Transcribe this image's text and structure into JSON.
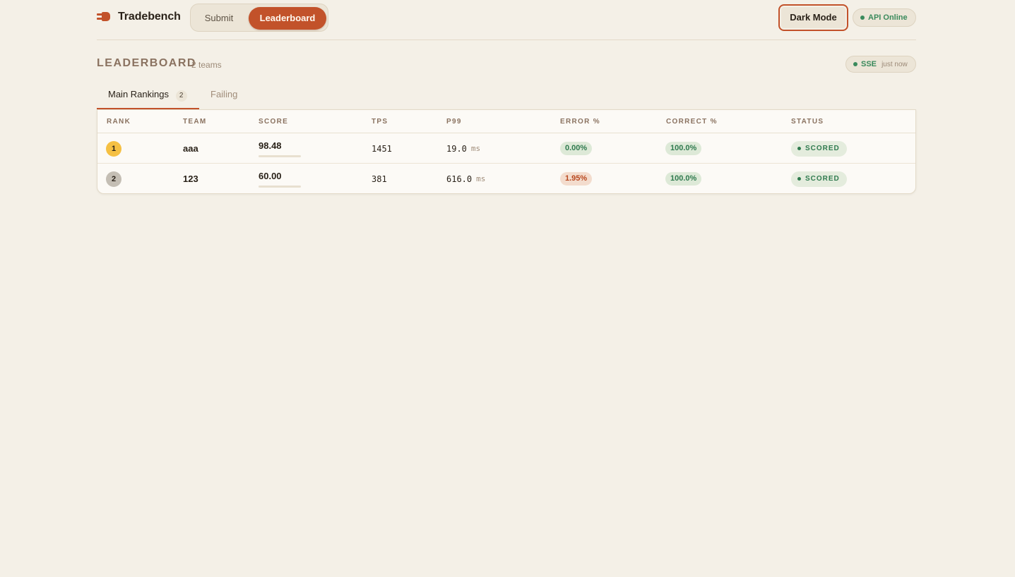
{
  "header": {
    "brand": "Tradebench",
    "nav": {
      "submit": "Submit",
      "leaderboard": "Leaderboard"
    },
    "dark_mode": "Dark Mode",
    "api_status": "API Online"
  },
  "leaderboard": {
    "title": "LEADERBOARD",
    "team_count": "2 teams",
    "sse_label": "SSE",
    "sse_time": "just now",
    "tabs": {
      "main": {
        "label": "Main Rankings",
        "count": "2"
      },
      "failing": {
        "label": "Failing"
      }
    },
    "columns": [
      "RANK",
      "TEAM",
      "SCORE",
      "TPS",
      "P99",
      "ERROR %",
      "CORRECT %",
      "STATUS"
    ],
    "rows": [
      {
        "rank": "1",
        "team": "aaa",
        "score": "98.48",
        "score_fraction": 0.98,
        "tps": "1451",
        "p99": "19.0",
        "p99_unit": "ms",
        "error": "0.00%",
        "correct": "100.0%",
        "status": "SCORED"
      },
      {
        "rank": "2",
        "team": "123",
        "score": "60.00",
        "score_fraction": 0.6,
        "tps": "381",
        "p99": "616.0",
        "p99_unit": "ms",
        "error": "1.95%",
        "correct": "100.0%",
        "status": "SCORED"
      }
    ]
  },
  "colors": {
    "accent": "#c2522a",
    "background": "#f4f0e7",
    "success": "#3a8a5c",
    "rank1_badge": "#f5c043",
    "rank2_badge": "#c4beb4"
  }
}
